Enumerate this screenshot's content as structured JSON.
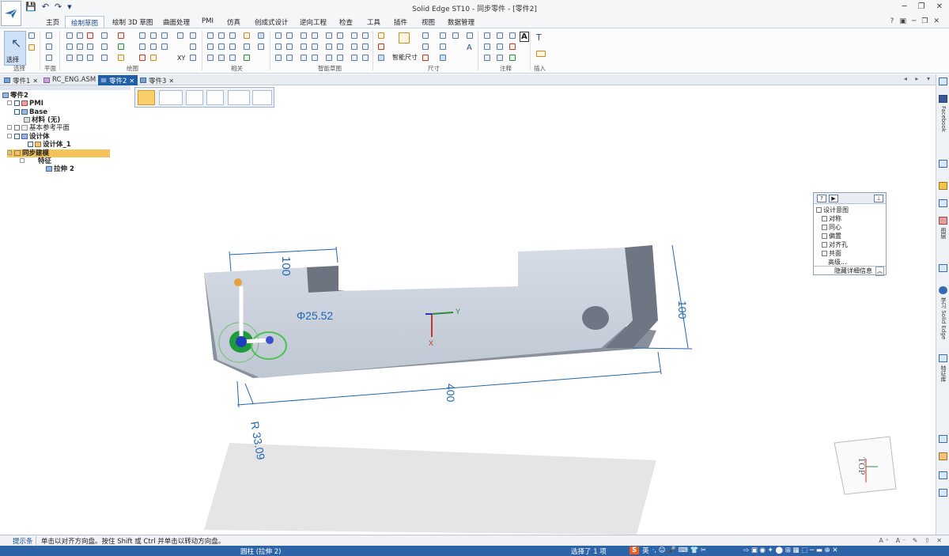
{
  "app": {
    "title": "Solid Edge ST10 - 同步零件 - [零件2]",
    "window_controls": [
      "─",
      "❐",
      "✕"
    ],
    "qat": [
      "💾",
      "↶",
      "↷",
      "▾"
    ]
  },
  "ribbon_tabs": [
    "主页",
    "绘制草图",
    "绘制 3D 草图",
    "曲面处理",
    "PMI",
    "仿真",
    "创成式设计",
    "逆向工程",
    "检查",
    "工具",
    "插件",
    "视图",
    "数据管理"
  ],
  "ribbon_tab_icons": [
    "?",
    "▣",
    "─",
    "❐",
    "✕"
  ],
  "ribbon": {
    "select_label": "选择",
    "groups": [
      "选择",
      "平面",
      "绘图",
      "相关",
      "智能草图",
      "尺寸",
      "注释",
      "插入"
    ],
    "smart_dim_label": "智能尺寸"
  },
  "doc_tabs": [
    {
      "label": "零件1"
    },
    {
      "label": "RC_ENG.ASM"
    },
    {
      "label": "零件2"
    },
    {
      "label": "零件3"
    }
  ],
  "doc_tab_close": "✕",
  "doc_arrows": "◂ ▸ ▾",
  "tree": {
    "root": "零件2",
    "pmi": "PMI",
    "base": "Base",
    "material": "材料 (无)",
    "ref_planes": "基本参考平面",
    "design_body": "设计体",
    "design_body_1": "设计体_1",
    "sync": "同步建模",
    "features": "特征",
    "extrude": "拉伸 2"
  },
  "viewport": {
    "dim_top": "100",
    "dim_dia": "Φ25.52",
    "dim_height": "100",
    "dim_len": "400",
    "dim_radius": "R 33.09",
    "triad_x": "X",
    "triad_y": "Y",
    "view_cube": "TOP"
  },
  "intent_panel": {
    "buttons": [
      "?",
      "▶",
      "⊥"
    ],
    "title": "设计意图",
    "items": [
      "对称",
      "同心",
      "偏置",
      "对齐孔",
      "共面"
    ],
    "advanced": "高级...",
    "hide_details": "隐藏详细信息",
    "collapse": "︽"
  },
  "right_bar": {
    "facebook": "Facebook",
    "layers": "图层",
    "learn": "学习 Solid Edge",
    "features": "特征库"
  },
  "hint": {
    "label": "提示条",
    "message": "单击以对齐方向盘。按住 Shift 或 Ctrl 并单击以转动方向盘。",
    "icons": "A⁺ A⁻ ✎ ⇧ ✕"
  },
  "status": {
    "middle": "圆柱 (拉伸 2)",
    "selection": "选择了 1 项",
    "ime_logo": "S",
    "ime_lang": "英",
    "ime_icons": "·, ☺ 🎤 ⌨ 👕 ✂",
    "right_icons": "⇨ ▣ ◉ ✦ ⬤ ⊞ ▦ ⬚ ─ ▬ ⊕ ✕"
  },
  "colors": {
    "accent": "#2d64a8",
    "selected_tree": "#f6c35b",
    "dimension_blue": "#1f67b4",
    "model_face": "#c9d1dd",
    "model_dark": "#6f7683"
  }
}
